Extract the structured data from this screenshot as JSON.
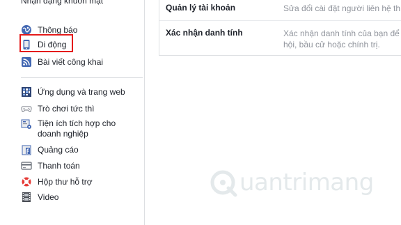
{
  "sidebar": {
    "top_cut_label": "Nhận dạng khuôn mặt",
    "items": [
      {
        "label": "Thông báo",
        "icon": "globe-icon"
      },
      {
        "label": "Di động",
        "icon": "mobile-phone-icon"
      },
      {
        "label": "Bài viết công khai",
        "icon": "rss-icon"
      },
      {
        "label": "Ứng dụng và trang web",
        "icon": "apps-grid-icon"
      },
      {
        "label": "Trò chơi tức thì",
        "icon": "gamepad-icon"
      },
      {
        "label": "Tiện ích tích hợp cho doanh nghiệp",
        "icon": "business-gear-icon"
      },
      {
        "label": "Quảng cáo",
        "icon": "ads-icon"
      },
      {
        "label": "Thanh toán",
        "icon": "credit-card-icon"
      },
      {
        "label": "Hộp thư hỗ trợ",
        "icon": "lifebuoy-icon"
      },
      {
        "label": "Video",
        "icon": "film-icon"
      }
    ]
  },
  "settings_rows": [
    {
      "title": "Quản lý tài khoản",
      "description": "Sửa đổi cài đặt người liên hệ th"
    },
    {
      "title": "Xác nhận danh tính",
      "description": "Xác nhận danh tính của bạn để",
      "description_line2": "hội, bầu cử hoặc chính trị."
    }
  ],
  "watermark": {
    "text": "uantrimang"
  },
  "colors": {
    "highlight": "#e41a1a",
    "facebook_blue": "#4267b2",
    "muted_text": "#90949c"
  }
}
